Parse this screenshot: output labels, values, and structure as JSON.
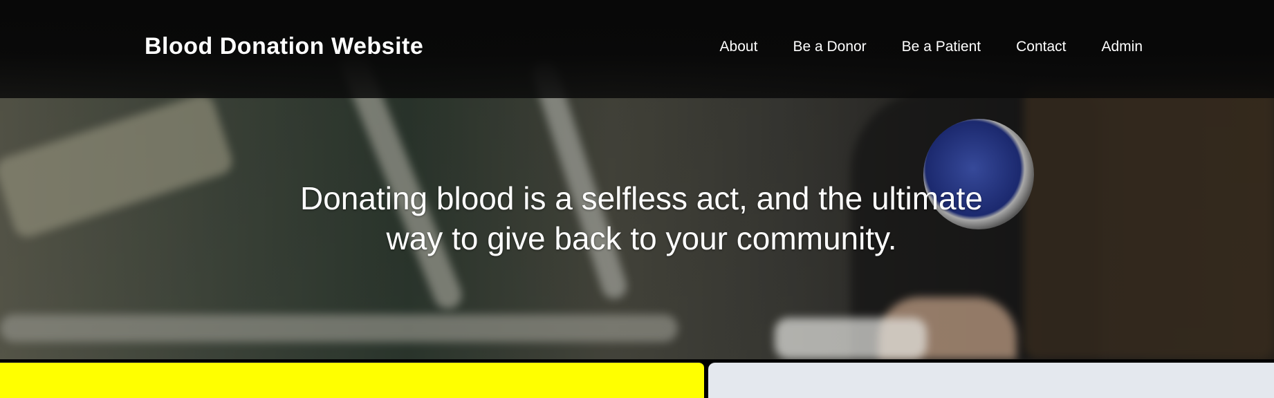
{
  "header": {
    "brand": "Blood Donation Website",
    "nav": [
      {
        "label": "About"
      },
      {
        "label": "Be a Donor"
      },
      {
        "label": "Be a Patient"
      },
      {
        "label": "Contact"
      },
      {
        "label": "Admin"
      }
    ]
  },
  "hero": {
    "headline": "Donating blood is a selfless act, and the ultimate way to give back to your community."
  },
  "colors": {
    "topbar": "#080808",
    "accent_yellow": "#ffff00",
    "panel_gray": "#e4e8ee",
    "text": "#ffffff"
  }
}
